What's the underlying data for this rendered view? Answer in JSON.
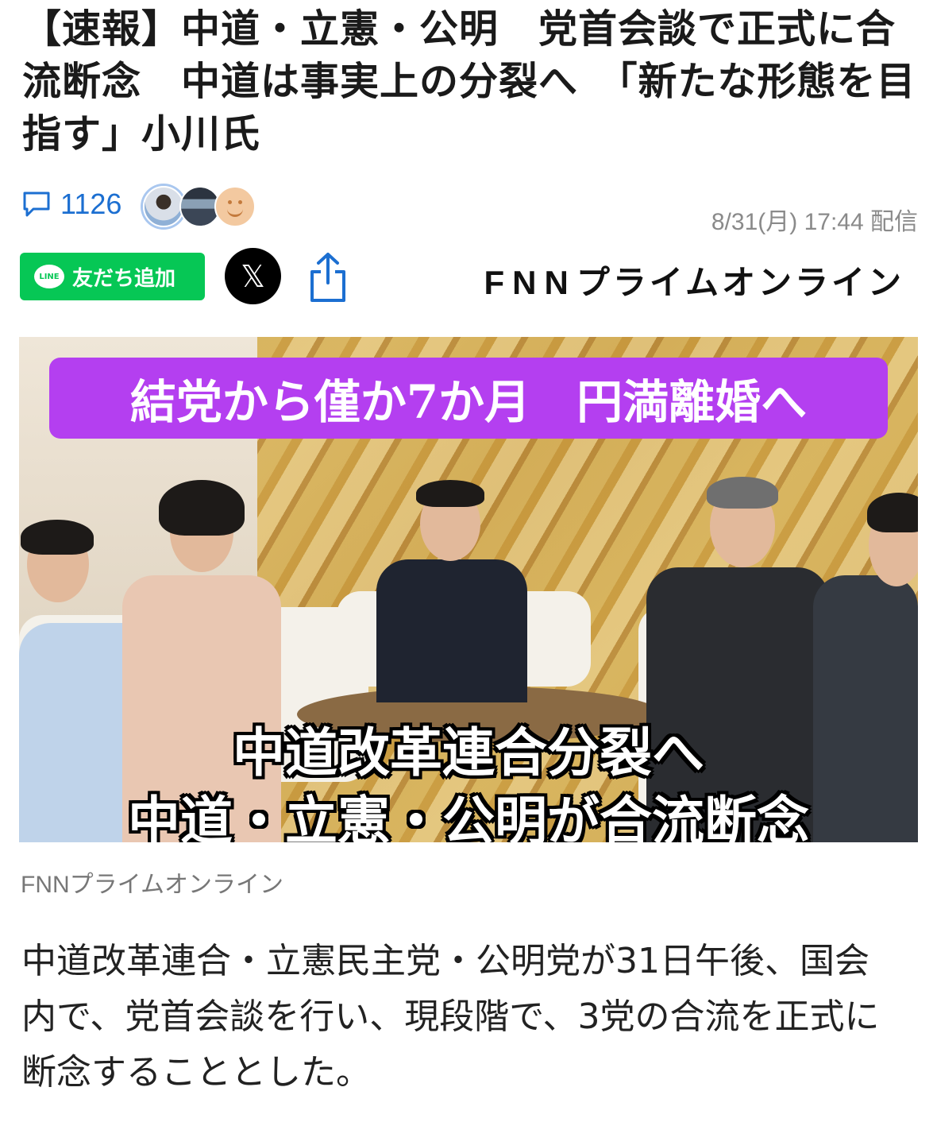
{
  "article": {
    "headline": "【速報】中道・立憲・公明　党首会談で正式に合流断念　中道は事実上の分裂へ　「新たな形態を目指す」小川氏",
    "comment_count": "1126",
    "date": "8/31(月) 17:44 配信",
    "body": "中道改革連合・立憲民主党・公明党が31日午後、国会内で、党首会談を行い、現段階で、3党の合流を正式に断念することとした。"
  },
  "share": {
    "line_logo": "LINE",
    "line_label": "友だち追加",
    "x_label": "𝕏",
    "icons": [
      "comment-icon",
      "share-icon"
    ]
  },
  "brand": {
    "prefix": "FNN",
    "suffix": "プライムオンライン"
  },
  "image": {
    "top_caption": "結党から僅か7か月　円満離婚へ",
    "bottom_caption_1": "中道改革連合分裂へ",
    "bottom_caption_2": "中道・立憲・公明が合流断念",
    "credit": "FNNプライムオンライン"
  },
  "colors": {
    "link_blue": "#1c6fd1",
    "line_green": "#06c755",
    "caption_purple": "#b43ff0"
  }
}
